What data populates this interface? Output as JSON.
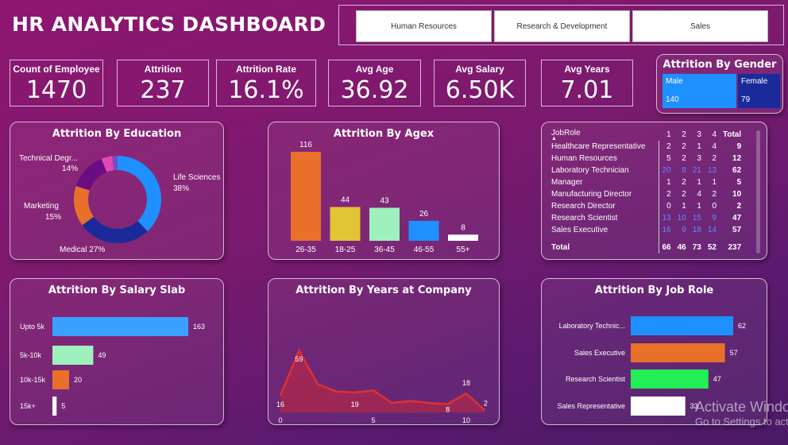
{
  "title": "HR ANALYTICS DASHBOARD",
  "slicer": [
    "Human Resources",
    "Research & Development",
    "Sales"
  ],
  "kpis": [
    {
      "label": "Count of Employee",
      "value": "1470"
    },
    {
      "label": "Attrition",
      "value": "237"
    },
    {
      "label": "Attrition Rate",
      "value": "16.1%"
    },
    {
      "label": "Avg Age",
      "value": "36.92"
    },
    {
      "label": "Avg Salary",
      "value": "6.50K"
    },
    {
      "label": "Avg Years",
      "value": "7.01"
    }
  ],
  "gender": {
    "title": "Attrition By Gender",
    "male_label": "Male",
    "male_value": "140",
    "female_label": "Female",
    "female_value": "79",
    "colors": {
      "male": "#1e90ff",
      "female": "#1a2a9a"
    }
  },
  "chart_data": [
    {
      "type": "pie",
      "title": "Attrition By Education",
      "donut": true,
      "slices": [
        {
          "label": "Life Sciences",
          "pct": "38%",
          "value": 38,
          "color": "#1e90ff"
        },
        {
          "label": "Medical",
          "pct": "27%",
          "value": 27,
          "color": "#1a2a9a"
        },
        {
          "label": "Marketing",
          "pct": "15%",
          "value": 15,
          "color": "#e8702a"
        },
        {
          "label": "Technical Degr...",
          "pct": "14%",
          "value": 14,
          "color": "#6a0d83"
        },
        {
          "label": "",
          "pct": "",
          "value": 4,
          "color": "#e048b0"
        },
        {
          "label": "",
          "pct": "",
          "value": 2,
          "color": "#7a4cc8"
        }
      ]
    },
    {
      "type": "bar",
      "title": "Attrition By Agex",
      "categories": [
        "26-35",
        "18-25",
        "36-45",
        "46-55",
        "55+"
      ],
      "values": [
        116,
        44,
        43,
        26,
        8
      ],
      "colors": [
        "#e8702a",
        "#e3c435",
        "#9ef0bd",
        "#1e90ff",
        "#ffffff"
      ]
    },
    {
      "type": "bar",
      "orientation": "horizontal",
      "title": "Attrition By Salary Slab",
      "categories": [
        "Upto 5k",
        "5k-10k",
        "10k-15k",
        "15k+"
      ],
      "values": [
        163,
        49,
        20,
        5
      ],
      "colors": [
        "#3aa0ff",
        "#9ef0bd",
        "#e8702a",
        "#ffffff"
      ]
    },
    {
      "type": "area",
      "title": "Attrition By Years at Company",
      "x": [
        0,
        1,
        2,
        3,
        4,
        5,
        6,
        7,
        8,
        9,
        10,
        11
      ],
      "values": [
        16,
        59,
        27,
        20,
        19,
        21,
        9,
        11,
        9,
        8,
        18,
        2
      ],
      "labeled": {
        "0": "16",
        "1": "59",
        "4": "19",
        "9": "8",
        "10": "18",
        "11": "2"
      },
      "xticks": [
        "0",
        "5",
        "10"
      ],
      "color": "#e03030"
    },
    {
      "type": "bar",
      "orientation": "horizontal",
      "title": "Attrition By Job Role",
      "categories": [
        "Laboratory Technic...",
        "Sales Executive",
        "Research Scientist",
        "Sales Representative"
      ],
      "values": [
        62,
        57,
        47,
        33
      ],
      "colors": [
        "#1e90ff",
        "#e8702a",
        "#22ee55",
        "#ffffff"
      ]
    }
  ],
  "table": {
    "headers": [
      "JobRole",
      "1",
      "2",
      "3",
      "4",
      "Total"
    ],
    "rows": [
      [
        "Healthcare Representative",
        "2",
        "2",
        "1",
        "4",
        "9"
      ],
      [
        "Human Resources",
        "5",
        "2",
        "3",
        "2",
        "12"
      ],
      [
        "Laboratory Technician",
        "20",
        "8",
        "21",
        "13",
        "62"
      ],
      [
        "Manager",
        "1",
        "2",
        "1",
        "1",
        "5"
      ],
      [
        "Manufacturing Director",
        "2",
        "2",
        "4",
        "2",
        "10"
      ],
      [
        "Research Director",
        "0",
        "1",
        "1",
        "0",
        "2"
      ],
      [
        "Research Scientist",
        "13",
        "10",
        "15",
        "9",
        "47"
      ],
      [
        "Sales Executive",
        "16",
        "9",
        "18",
        "14",
        "57"
      ]
    ],
    "total": [
      "Total",
      "66",
      "46",
      "73",
      "52",
      "237"
    ]
  },
  "watermark": {
    "line1": "Activate Windows",
    "line2": "Go to Settings to activate Windows."
  }
}
